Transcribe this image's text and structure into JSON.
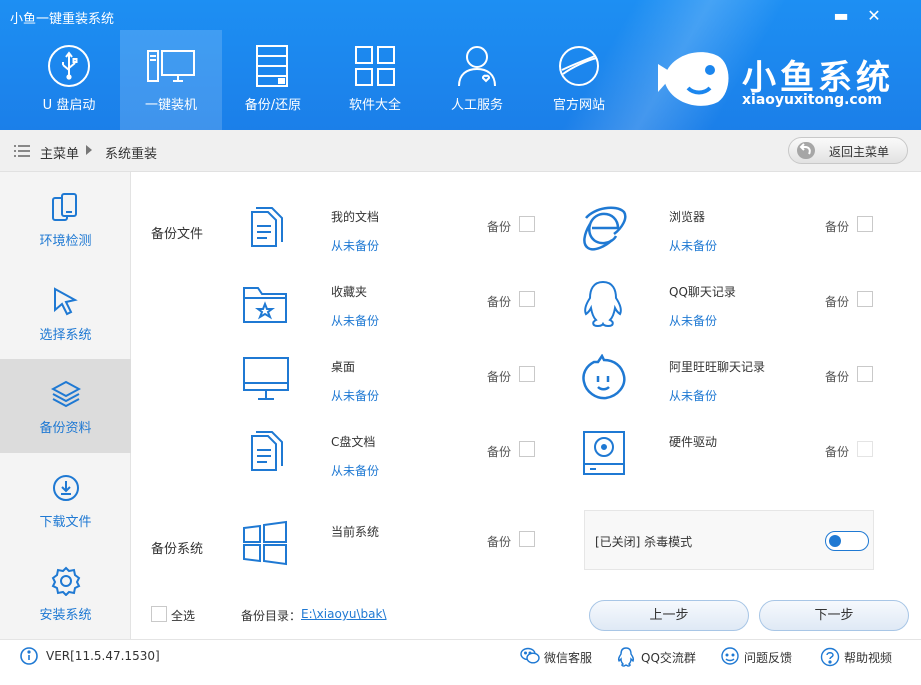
{
  "window": {
    "title": "小鱼一键重装系统",
    "minimize": "▬",
    "close": "✕"
  },
  "nav": [
    {
      "id": "usb",
      "label": "U 盘启动"
    },
    {
      "id": "install",
      "label": "一键装机",
      "active": true
    },
    {
      "id": "backup",
      "label": "备份/还原"
    },
    {
      "id": "software",
      "label": "软件大全"
    },
    {
      "id": "service",
      "label": "人工服务"
    },
    {
      "id": "website",
      "label": "官方网站"
    }
  ],
  "brand": {
    "name": "小鱼系统",
    "url": "xiaoyuxitong.com"
  },
  "breadcrumb": {
    "root": "主菜单",
    "current": "系统重装",
    "back_label": "返回主菜单"
  },
  "sidebar": [
    {
      "label": "环境检测",
      "icon": "phone-copy-icon"
    },
    {
      "label": "选择系统",
      "icon": "cursor-icon"
    },
    {
      "label": "备份资料",
      "icon": "layers-icon",
      "active": true
    },
    {
      "label": "下载文件",
      "icon": "download-circle-icon"
    },
    {
      "label": "安装系统",
      "icon": "gear-icon"
    }
  ],
  "main": {
    "backup_files_label": "备份文件",
    "backup_system_label": "备份系统",
    "backup_word": "备份",
    "left_items": [
      {
        "name": "我的文档",
        "status": "从未备份",
        "icon": "documents-icon"
      },
      {
        "name": "收藏夹",
        "status": "从未备份",
        "icon": "star-folder-icon"
      },
      {
        "name": "桌面",
        "status": "从未备份",
        "icon": "monitor-icon"
      },
      {
        "name": "C盘文档",
        "status": "从未备份",
        "icon": "documents-icon"
      }
    ],
    "right_items": [
      {
        "name": "浏览器",
        "status": "从未备份",
        "icon": "ie-browser-icon"
      },
      {
        "name": "QQ聊天记录",
        "status": "从未备份",
        "icon": "qq-penguin-icon"
      },
      {
        "name": "阿里旺旺聊天记录",
        "status": "从未备份",
        "icon": "wangwang-icon"
      },
      {
        "name": "硬件驱动",
        "status": "",
        "icon": "hard-drive-icon",
        "disabled": true
      }
    ],
    "system_item": {
      "name": "当前系统",
      "icon": "windows-logo-icon"
    },
    "antivirus": {
      "text": "[已关闭] 杀毒模式",
      "enabled": false
    },
    "select_all": "全选",
    "backup_dir_label": "备份目录：",
    "backup_dir": "E:\\xiaoyu\\bak\\",
    "prev_button": "上一步",
    "next_button": "下一步"
  },
  "footer": {
    "version": "VER[11.5.47.1530]",
    "links": [
      {
        "label": "微信客服",
        "icon": "wechat-icon"
      },
      {
        "label": "QQ交流群",
        "icon": "qq-icon"
      },
      {
        "label": "问题反馈",
        "icon": "feedback-icon"
      },
      {
        "label": "帮助视频",
        "icon": "help-icon"
      }
    ]
  },
  "colors": {
    "header_blue": "#1b86ee",
    "accent_blue": "#1f79d3"
  }
}
